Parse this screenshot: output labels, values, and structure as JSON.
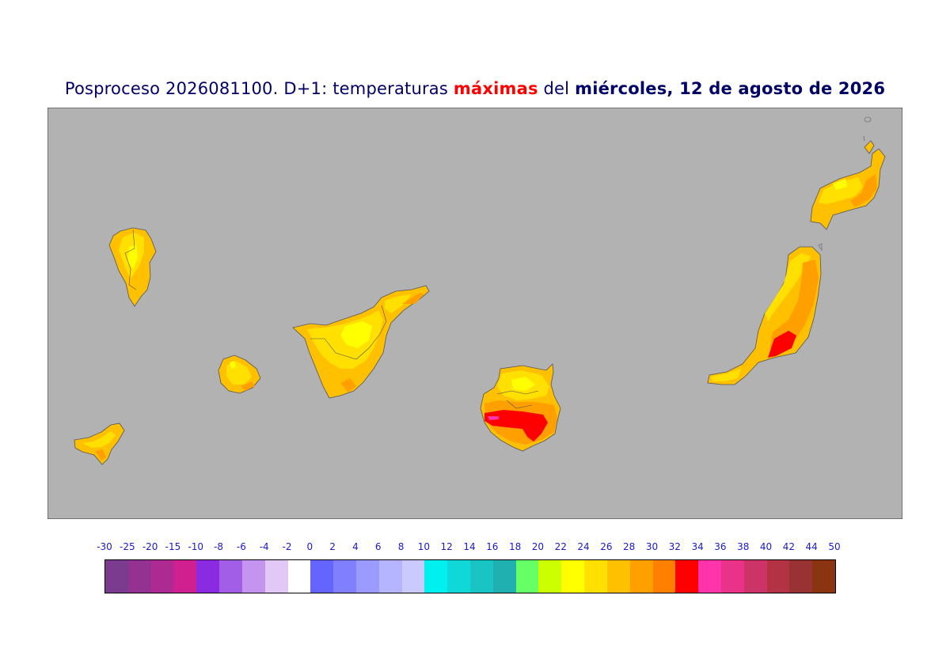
{
  "title": {
    "prefix": "Posproceso 2026081100. D+1: temperaturas",
    "highlight": "máximas",
    "highlight_color": "#ff0000",
    "connector": "del",
    "date": "miércoles, 12 de agosto de 2026",
    "color": "#000066"
  },
  "map": {
    "background_color": "#b2b2b2",
    "islands": [
      "la-palma",
      "el-hierro",
      "la-gomera",
      "tenerife",
      "gran-canaria",
      "fuerteventura",
      "lanzarote"
    ]
  },
  "legend": {
    "ticks": [
      "-30",
      "-25",
      "-20",
      "-15",
      "-10",
      "-8",
      "-6",
      "-4",
      "-2",
      "0",
      "2",
      "4",
      "6",
      "8",
      "10",
      "12",
      "14",
      "16",
      "18",
      "20",
      "22",
      "24",
      "26",
      "28",
      "30",
      "32",
      "34",
      "36",
      "38",
      "40",
      "42",
      "44",
      "50"
    ],
    "colors": [
      "#7b3b8e",
      "#933291",
      "#ae2a93",
      "#d01f8f",
      "#8a2be2",
      "#a35ee8",
      "#c494ee",
      "#e2c8f7",
      "#ffffff",
      "#6464ff",
      "#8080ff",
      "#9a9aff",
      "#b4b4ff",
      "#cacaff",
      "#00f0f0",
      "#10d8d8",
      "#18c4c4",
      "#20b0b0",
      "#66ff66",
      "#ccff00",
      "#ffff00",
      "#ffe000",
      "#ffc000",
      "#ffa000",
      "#ff8000",
      "#ff0000",
      "#ff33aa",
      "#e83388",
      "#cc3366",
      "#b33344",
      "#993333",
      "#8b3510"
    ]
  }
}
